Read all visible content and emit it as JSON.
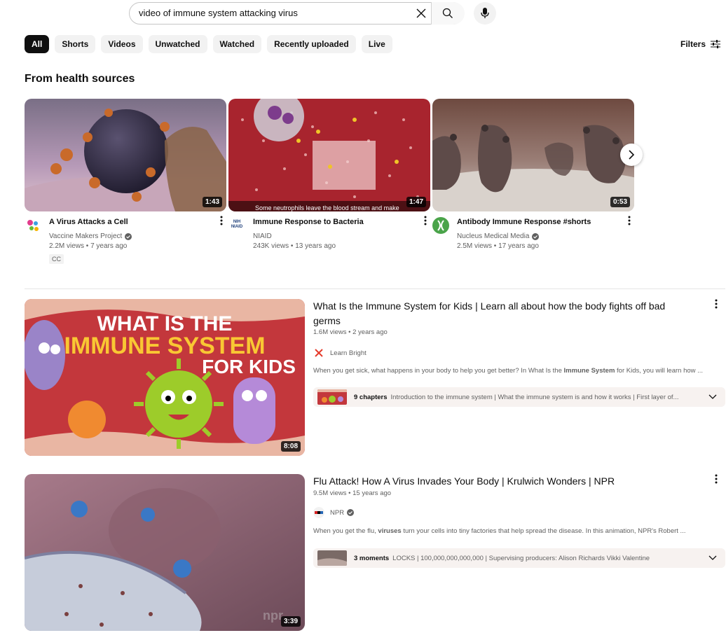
{
  "search": {
    "query": "video of immune system attacking virus"
  },
  "chips": [
    "All",
    "Shorts",
    "Videos",
    "Unwatched",
    "Watched",
    "Recently uploaded",
    "Live"
  ],
  "filters_label": "Filters",
  "shelf": {
    "title": "From health sources",
    "cards": [
      {
        "title": "A Virus Attacks a Cell",
        "channel": "Vaccine Makers Project",
        "verified": true,
        "views": "2.2M views",
        "age": "7 years ago",
        "duration": "1:43",
        "badge": "CC",
        "avatar_label": ""
      },
      {
        "title": "Immune Response to Bacteria",
        "channel": "NIAID",
        "verified": false,
        "views": "243K views",
        "age": "13 years ago",
        "duration": "1:47",
        "caption": "Some neutrophils leave the blood stream and make",
        "avatar_label": "NIH NIAID"
      },
      {
        "title": "Antibody Immune Response #shorts",
        "channel": "Nucleus Medical Media",
        "verified": true,
        "views": "2.5M views",
        "age": "17 years ago",
        "duration": "0:53",
        "avatar_label": ""
      }
    ]
  },
  "results": [
    {
      "title": "What Is the Immune System for Kids | Learn all about how the body fights off bad germs",
      "views": "1.6M views",
      "age": "2 years ago",
      "channel": "Learn Bright",
      "desc_pre": "When you get sick, what happens in your body to help you get better? In What Is the ",
      "desc_bold": "Immune System",
      "desc_post": " for Kids, you will learn how ...",
      "chapters_count": "9 chapters",
      "chapters_text": "Introduction to the immune system | What the immune system is and how it works | First layer of...",
      "duration": "8:08",
      "thumb_text": [
        "WHAT IS THE",
        "IMMUNE SYSTEM",
        "FOR KIDS"
      ]
    },
    {
      "title": "Flu Attack! How A Virus Invades Your Body | Krulwich Wonders | NPR",
      "views": "9.5M views",
      "age": "15 years ago",
      "channel": "NPR",
      "desc_pre": "When you get the flu, ",
      "desc_bold": "viruses",
      "desc_post": " turn your cells into tiny factories that help spread the disease. In this animation, NPR's Robert ...",
      "chapters_count": "3 moments",
      "chapters_text": "LOCKS | 100,000,000,000,000 | Supervising producers: Alison Richards Vikki Valentine",
      "duration": "3:39",
      "thumb_text": [
        "npr"
      ]
    }
  ]
}
